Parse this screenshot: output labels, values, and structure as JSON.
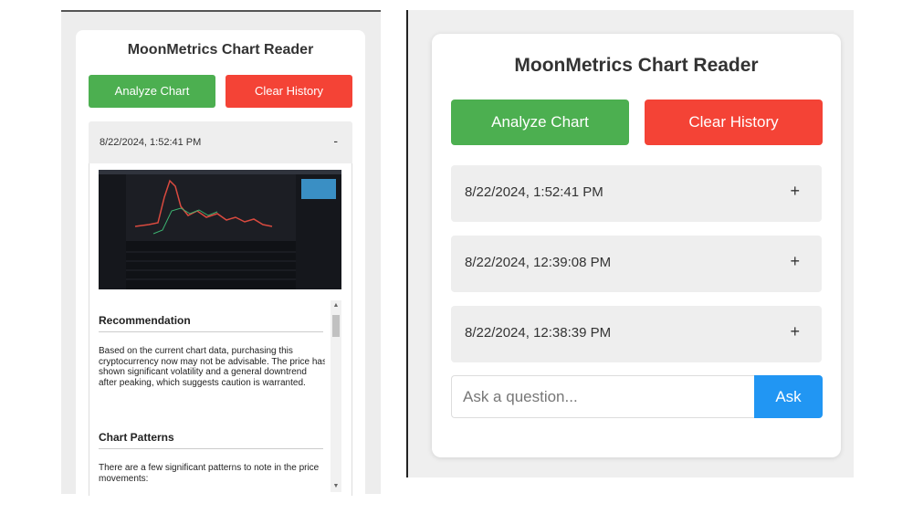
{
  "left_panel": {
    "title": "MoonMetrics Chart Reader",
    "analyze_label": "Analyze Chart",
    "clear_label": "Clear History",
    "entry": {
      "date": "8/22/2024, 1:52:41 PM",
      "toggle": "-",
      "sections": [
        {
          "title": "Recommendation",
          "text": "Based on the current chart data, purchasing this cryptocurrency now may not be advisable. The price has shown significant volatility and a general downtrend after peaking, which suggests caution is warranted."
        },
        {
          "title": "Chart Patterns",
          "text": "There are a few significant patterns to note in the price movements:"
        }
      ]
    }
  },
  "right_panel": {
    "title": "MoonMetrics Chart Reader",
    "analyze_label": "Analyze Chart",
    "clear_label": "Clear History",
    "entries": [
      {
        "date": "8/22/2024, 1:52:41 PM",
        "toggle": "+"
      },
      {
        "date": "8/22/2024, 12:39:08 PM",
        "toggle": "+"
      },
      {
        "date": "8/22/2024, 12:38:39 PM",
        "toggle": "+"
      }
    ],
    "ask_placeholder": "Ask a question...",
    "ask_label": "Ask"
  },
  "colors": {
    "analyze_button": "#4caf50",
    "clear_button": "#f44336",
    "ask_button": "#2196f3",
    "chart_background": "#1c1e24",
    "chart_price_line": "#d94a3f",
    "chart_price_line_alt": "#3cb371"
  },
  "icons": {
    "collapse": "minus-icon",
    "expand": "plus-icon"
  }
}
